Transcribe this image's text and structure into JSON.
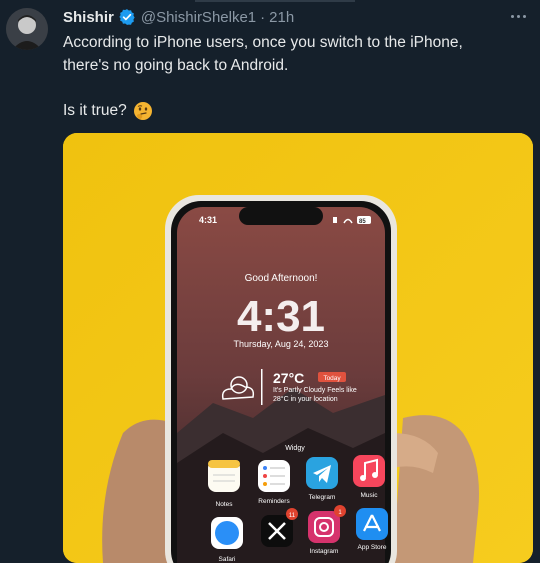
{
  "tweet": {
    "author_name": "Shishir",
    "handle": "@ShishirShelke1",
    "separator": "·",
    "time": "21h",
    "text_line1": "According to iPhone users, once you switch to the iPhone,",
    "text_line2": "there's no going back to Android.",
    "question": "Is it true?",
    "emoji_icon": "thinking-face-icon"
  },
  "phone": {
    "status_time": "4:31",
    "battery": "85",
    "greeting": "Good Afternoon!",
    "clock": "4:31",
    "date": "Thursday, Aug 24, 2023",
    "temperature": "27°C",
    "today_badge": "Today",
    "weather_line1": "It's Partly Cloudy Feels like",
    "weather_line2": "28°C in your location",
    "widget_label": "Widgy",
    "apps_row1": [
      "Notes",
      "Reminders",
      "Telegram",
      "Music"
    ],
    "apps_row2": [
      "Safari",
      "X",
      "Instagram",
      "App Store"
    ],
    "x_badge": "11",
    "instagram_badge": "1"
  },
  "colors": {
    "background": "#15202b",
    "verified_blue": "#1d9bf0",
    "media_yellow": "#f3c614"
  }
}
